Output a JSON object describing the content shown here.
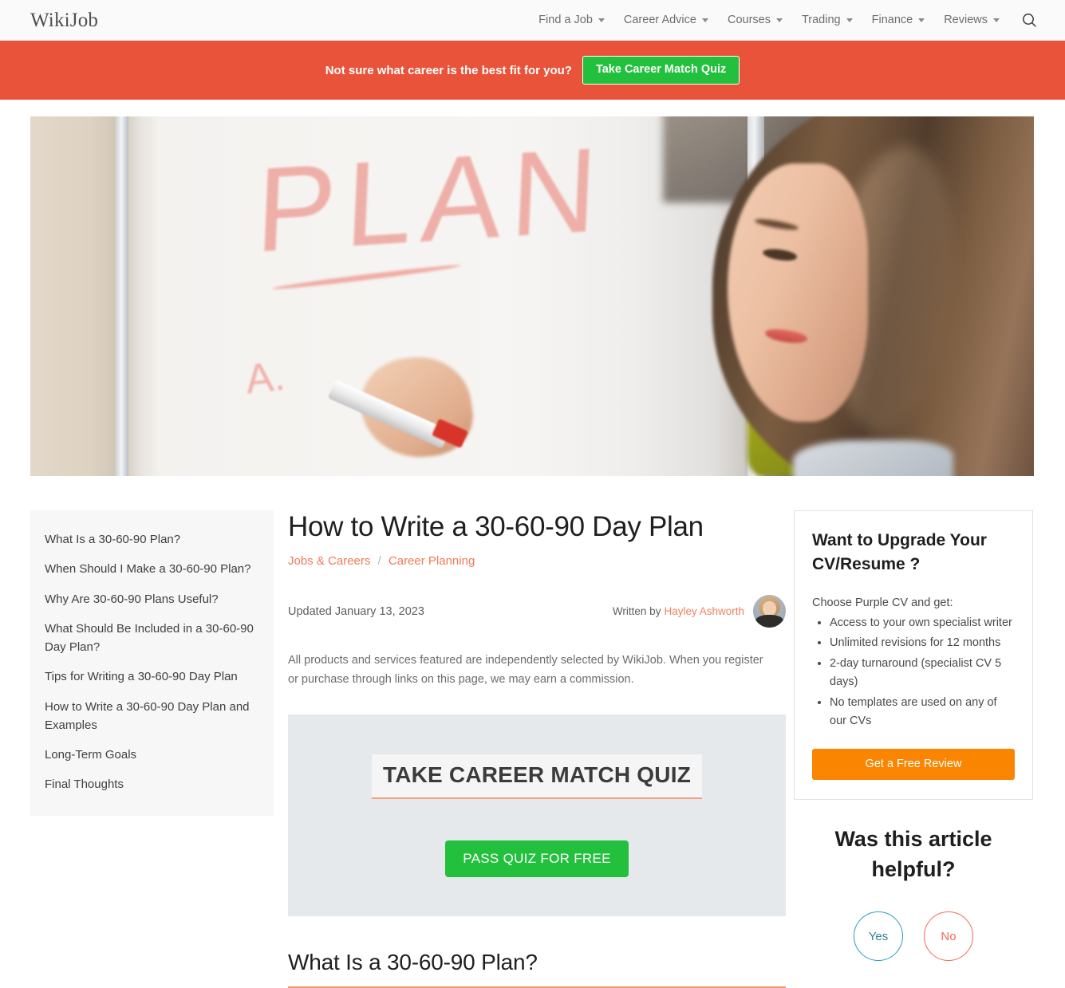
{
  "header": {
    "logo": "WikiJob",
    "nav": [
      {
        "label": "Find a Job",
        "has_dropdown": true
      },
      {
        "label": "Career Advice",
        "has_dropdown": true
      },
      {
        "label": "Courses",
        "has_dropdown": true
      },
      {
        "label": "Trading",
        "has_dropdown": true
      },
      {
        "label": "Finance",
        "has_dropdown": true
      },
      {
        "label": "Reviews",
        "has_dropdown": true
      }
    ],
    "search_icon": "search-icon"
  },
  "promo_banner": {
    "text": "Not sure what career is the best fit for you?",
    "button_label": "Take Career Match Quiz",
    "background_color": "#E8533A",
    "button_color": "#22C03C"
  },
  "hero": {
    "alt": "Woman writing the word PLAN on a whiteboard with a red marker",
    "whiteboard_text": "PLAN"
  },
  "toc": {
    "items": [
      "What Is a 30-60-90 Plan?",
      "When Should I Make a 30-60-90 Plan?",
      "Why Are 30-60-90 Plans Useful?",
      "What Should Be Included in a 30-60-90 Day Plan?",
      "Tips for Writing a 30-60-90 Day Plan",
      "How to Write a 30-60-90 Day Plan and Examples",
      "Long-Term Goals",
      "Final Thoughts"
    ]
  },
  "article": {
    "title": "How to Write a 30-60-90 Day Plan",
    "breadcrumb": {
      "primary": "Jobs & Careers",
      "separator": "/",
      "secondary": "Career Planning"
    },
    "updated": "Updated January 13, 2023",
    "written_by_prefix": "Written by",
    "author": "Hayley Ashworth",
    "disclaimer": "All products and services featured are independently selected by WikiJob. When you register or purchase through links on this page, we may earn a commission.",
    "section_heading": "What Is a 30-60-90 Plan?",
    "accent_color": "#F0825F"
  },
  "quiz_promo": {
    "heading": "TAKE CAREER MATCH QUIZ",
    "button_label": "PASS QUIZ FOR FREE",
    "background_color": "#E5E9EC",
    "button_color": "#22C03C"
  },
  "cv_card": {
    "title": "Want to Upgrade Your CV/Resume ?",
    "lead": "Choose Purple CV and get:",
    "bullets": [
      "Access to your own specialist writer",
      "Unlimited revisions for 12 months",
      "2-day turnaround (specialist CV 5 days)",
      "No templates are used on any of our CVs"
    ],
    "button_label": "Get a Free Review",
    "button_color": "#F98500"
  },
  "helpful": {
    "title": "Was this article helpful?",
    "yes_label": "Yes",
    "no_label": "No",
    "yes_color": "#2A9DBD",
    "no_color": "#F0695A"
  }
}
